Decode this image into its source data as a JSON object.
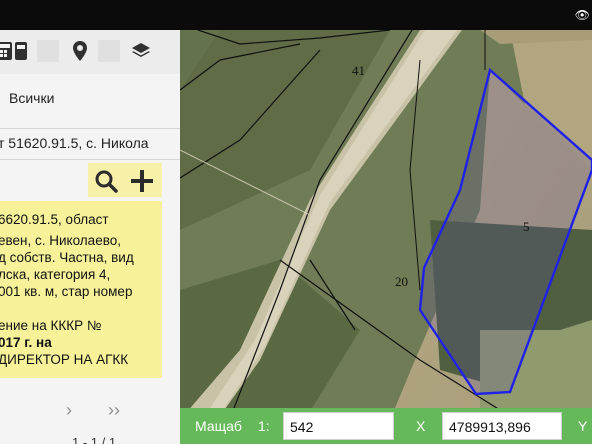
{
  "topbar": {
    "eye_icon": "eye-icon"
  },
  "toolbar": {
    "icons": [
      "calculator-icon",
      "mobile-icon",
      "map-marker-icon",
      "layers-icon"
    ]
  },
  "filter": {
    "label": "Всички"
  },
  "search": {
    "value": "т 51620.91.5, с. Никола"
  },
  "result": {
    "lines": [
      "6620.91.5, област",
      "евен, с. Николаево,",
      "д собств. Частна, вид",
      "лска, категория 4,",
      "001 кв. м, стар номер",
      "",
      "ение на КККР №",
      "017 г. на",
      "ДИРЕКТОР НА АГКК"
    ]
  },
  "pager": {
    "next": "›",
    "last": "››",
    "count": "1 - 1 / 1"
  },
  "map": {
    "labels": {
      "parcel_41": "41",
      "parcel_20": "20",
      "parcel_5": "5"
    },
    "highlight_color": "#1f21e6"
  },
  "statusbar": {
    "scale_label": "Мащаб",
    "scale_prefix": "1:",
    "scale_value": "542",
    "x_label": "X",
    "x_value": "4789913,896",
    "y_label": "Y"
  }
}
